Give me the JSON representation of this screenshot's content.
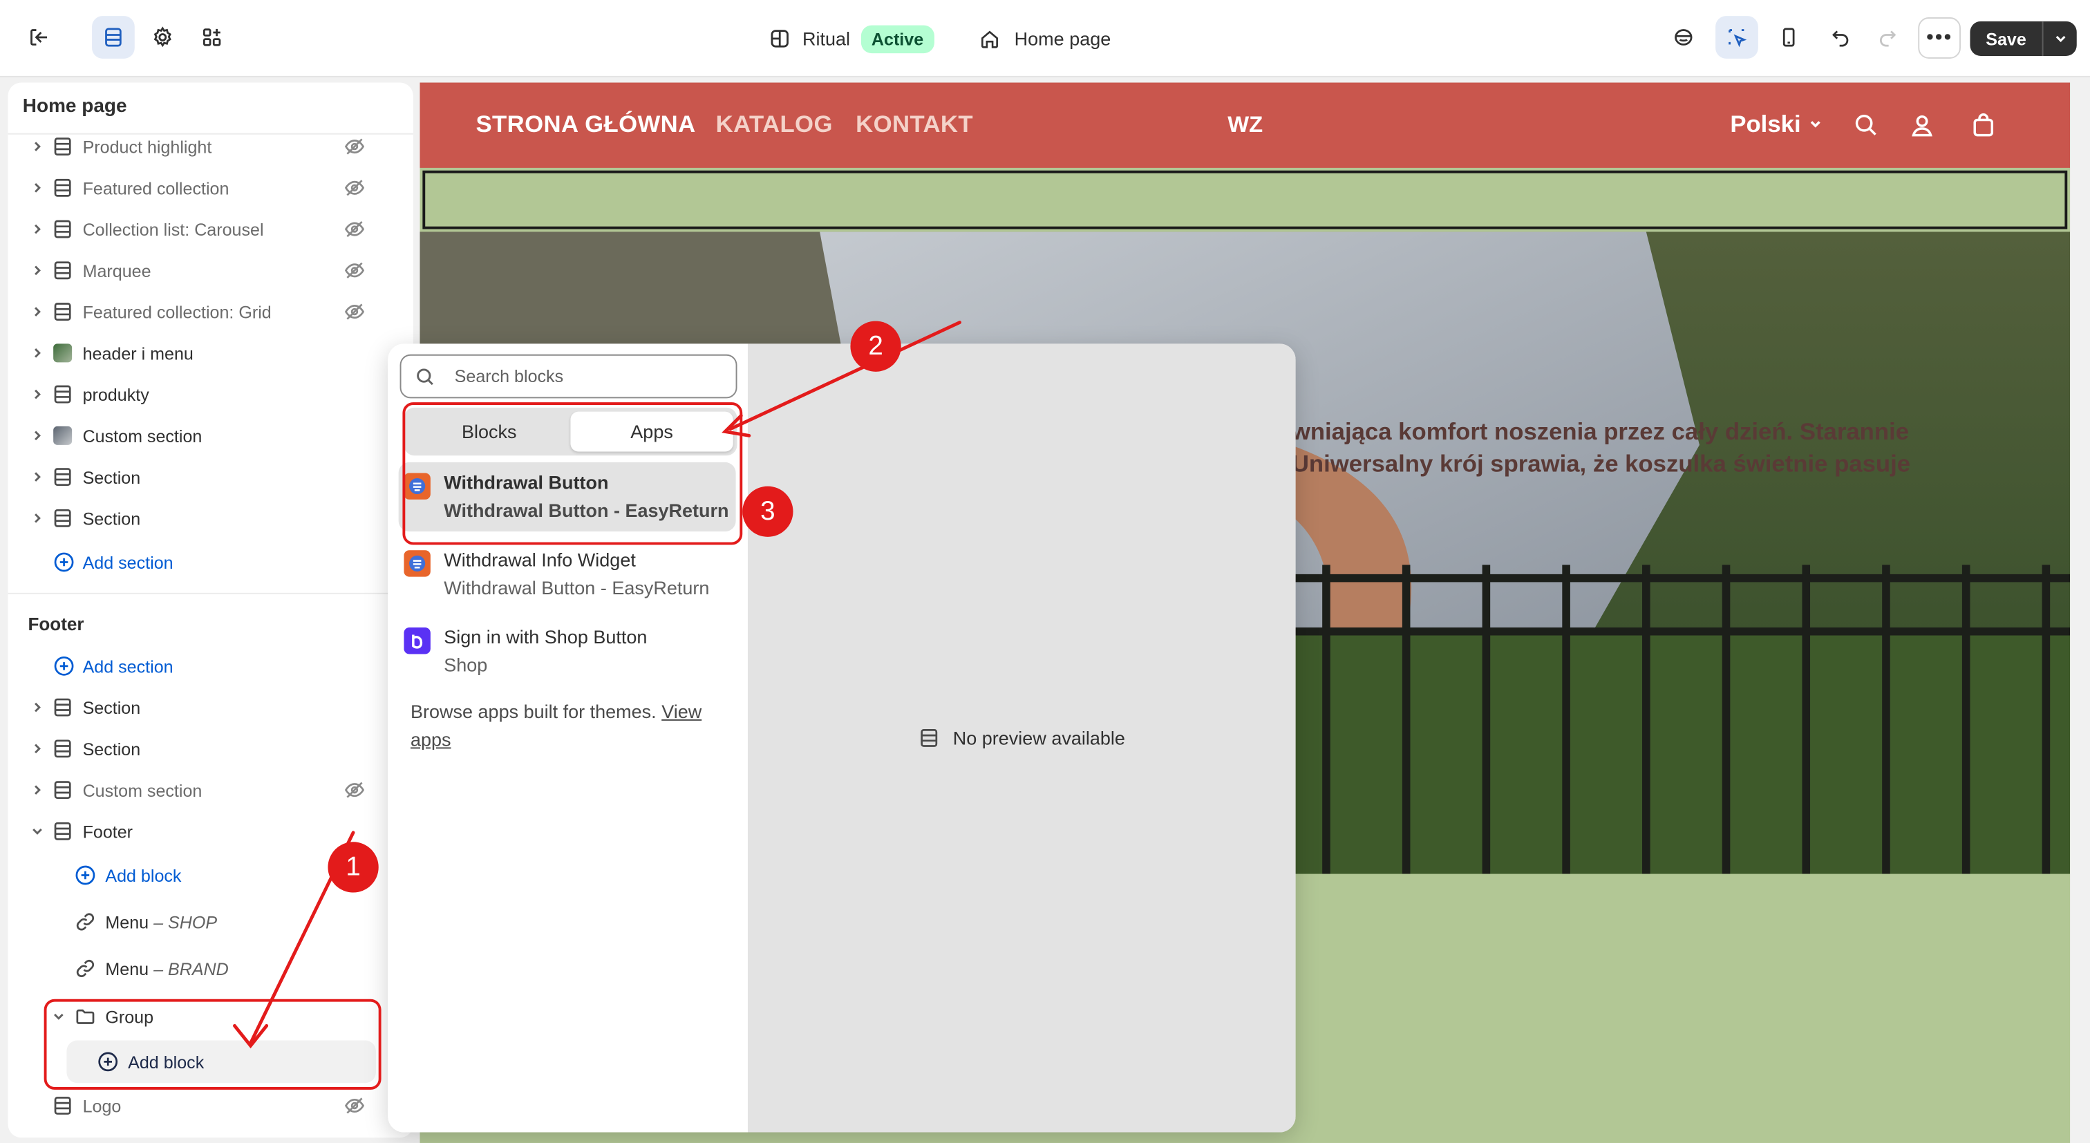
{
  "topbar": {
    "theme_name": "Ritual",
    "theme_status": "Active",
    "page_name": "Home page",
    "save_label": "Save"
  },
  "sidebar": {
    "title": "Home page",
    "sections": [
      {
        "label": "Product highlight",
        "hidden": true
      },
      {
        "label": "Featured collection",
        "hidden": true
      },
      {
        "label": "Collection list: Carousel",
        "hidden": true
      },
      {
        "label": "Marquee",
        "hidden": true
      },
      {
        "label": "Featured collection: Grid",
        "hidden": true
      },
      {
        "label": "header i menu",
        "hidden": false
      },
      {
        "label": "produkty",
        "hidden": false
      },
      {
        "label": "Custom section",
        "hidden": false
      },
      {
        "label": "Section",
        "hidden": false
      },
      {
        "label": "Section",
        "hidden": false
      }
    ],
    "add_section_label": "Add section",
    "footer_title": "Footer",
    "footer_add_section_label": "Add section",
    "footer_sections": [
      {
        "label": "Section"
      },
      {
        "label": "Section"
      },
      {
        "label": "Custom section",
        "hidden": true
      },
      {
        "label": "Footer"
      }
    ],
    "footer_add_block_label": "Add block",
    "menu_items": [
      {
        "label": "Menu",
        "sep": " – ",
        "sub": "SHOP"
      },
      {
        "label": "Menu",
        "sep": " – ",
        "sub": "BRAND"
      }
    ],
    "group_label": "Group",
    "group_add_block_label": "Add block",
    "logo_label": "Logo"
  },
  "store": {
    "nav": [
      "STRONA GŁÓWNA",
      "KATALOG",
      "KONTAKT"
    ],
    "logo": "WZ",
    "language": "Polski",
    "hero_text_line1": "wniająca komfort noszenia przez cały dzień. Starannie",
    "hero_text_line2": "Uniwersalny krój sprawia, że koszulka świetnie pasuje"
  },
  "picker": {
    "search_placeholder": "Search blocks",
    "tabs": [
      "Blocks",
      "Apps"
    ],
    "active_tab": "Apps",
    "apps": [
      {
        "name": "Withdrawal Button",
        "sub": "Withdrawal Button - EasyReturn",
        "selected": true
      },
      {
        "name": "Withdrawal Info Widget",
        "sub": "Withdrawal Button - EasyReturn",
        "selected": false
      },
      {
        "name": "Sign in with Shop Button",
        "sub": "Shop",
        "selected": false
      }
    ],
    "browse_text": "Browse apps built for themes. ",
    "browse_link": "View apps",
    "no_preview": "No preview available"
  },
  "annotations": [
    "1",
    "2",
    "3"
  ],
  "colors": {
    "store_header": "#c9564d",
    "store_bg": "#b2c795",
    "annotation_red": "#e31b1b",
    "link_blue": "#005bd3"
  }
}
